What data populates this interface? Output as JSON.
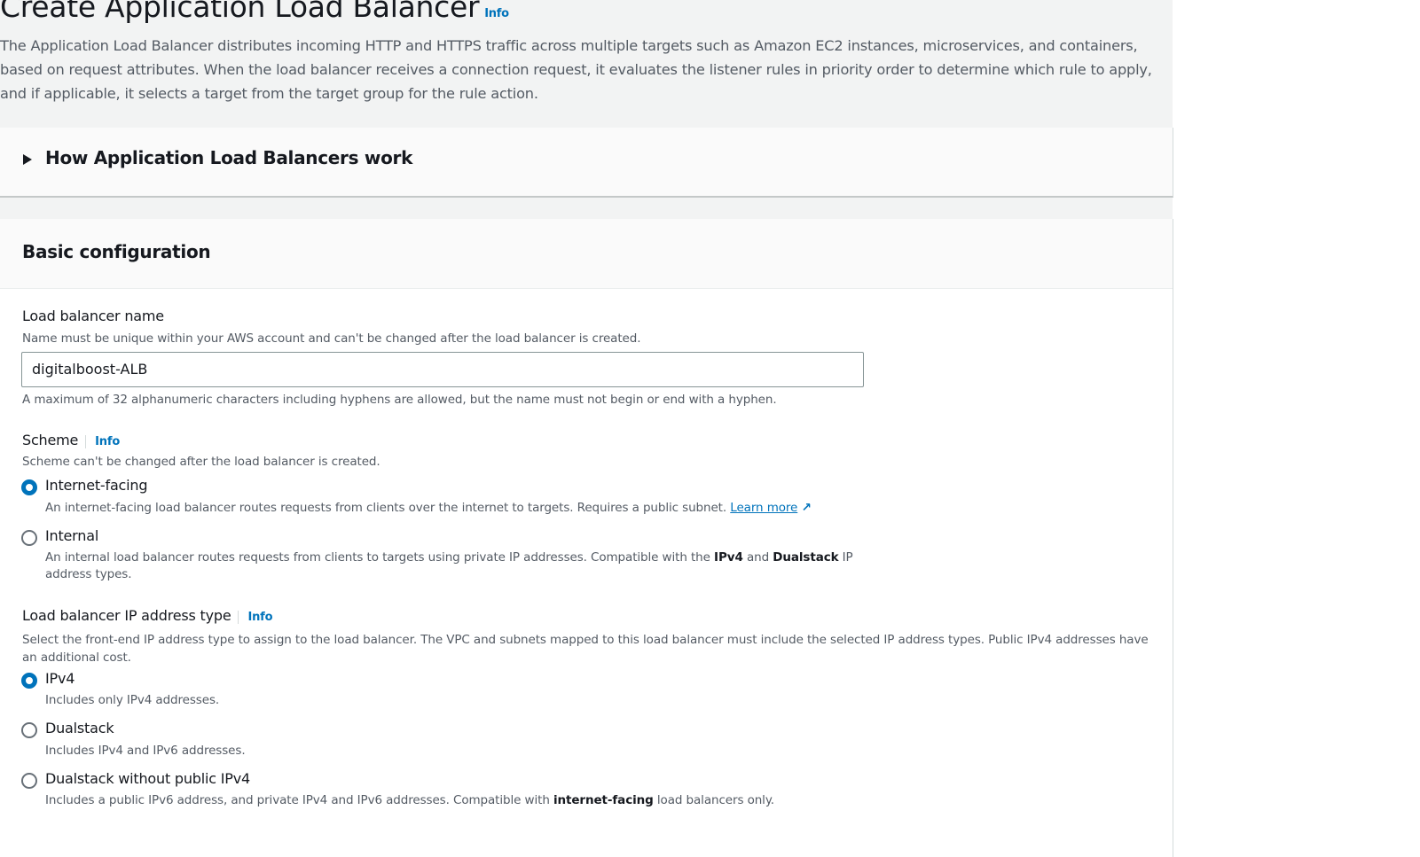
{
  "page": {
    "title": "Create Application Load Balancer",
    "info": "Info",
    "description": "The Application Load Balancer distributes incoming HTTP and HTTPS traffic across multiple targets such as Amazon EC2 instances, microservices, and containers, based on request attributes. When the load balancer receives a connection request, it evaluates the listener rules in priority order to determine which rule to apply, and if applicable, it selects a target from the target group for the rule action."
  },
  "how_it_works": {
    "label": "How Application Load Balancers work"
  },
  "basic": {
    "title": "Basic configuration",
    "name": {
      "label": "Load balancer name",
      "help": "Name must be unique within your AWS account and can't be changed after the load balancer is created.",
      "value": "digitalboost-ALB",
      "constraint": "A maximum of 32 alphanumeric characters including hyphens are allowed, but the name must not begin or end with a hyphen."
    },
    "scheme": {
      "label": "Scheme",
      "info": "Info",
      "help": "Scheme can't be changed after the load balancer is created.",
      "options": [
        {
          "label": "Internet-facing",
          "desc": "An internet-facing load balancer routes requests from clients over the internet to targets. Requires a public subnet.",
          "link": "Learn more",
          "selected": true
        },
        {
          "label": "Internal",
          "desc1": "An internal load balancer routes requests from clients to targets using private IP addresses. Compatible with the ",
          "b1": "IPv4",
          "mid": " and ",
          "b2": "Dualstack",
          "desc2": " IP",
          "desc3": "address types.",
          "selected": false
        }
      ]
    },
    "ip": {
      "label": "Load balancer IP address type",
      "info": "Info",
      "help": "Select the front-end IP address type to assign to the load balancer. The VPC and subnets mapped to this load balancer must include the selected IP address types. Public IPv4 addresses have an additional cost.",
      "options": [
        {
          "label": "IPv4",
          "desc": "Includes only IPv4 addresses.",
          "selected": true
        },
        {
          "label": "Dualstack",
          "desc": "Includes IPv4 and IPv6 addresses.",
          "selected": false
        },
        {
          "label": "Dualstack without public IPv4",
          "desc1": "Includes a public IPv6 address, and private IPv4 and IPv6 addresses. Compatible with ",
          "b": "internet-facing",
          "desc2": " load balancers only.",
          "selected": false
        }
      ]
    }
  }
}
